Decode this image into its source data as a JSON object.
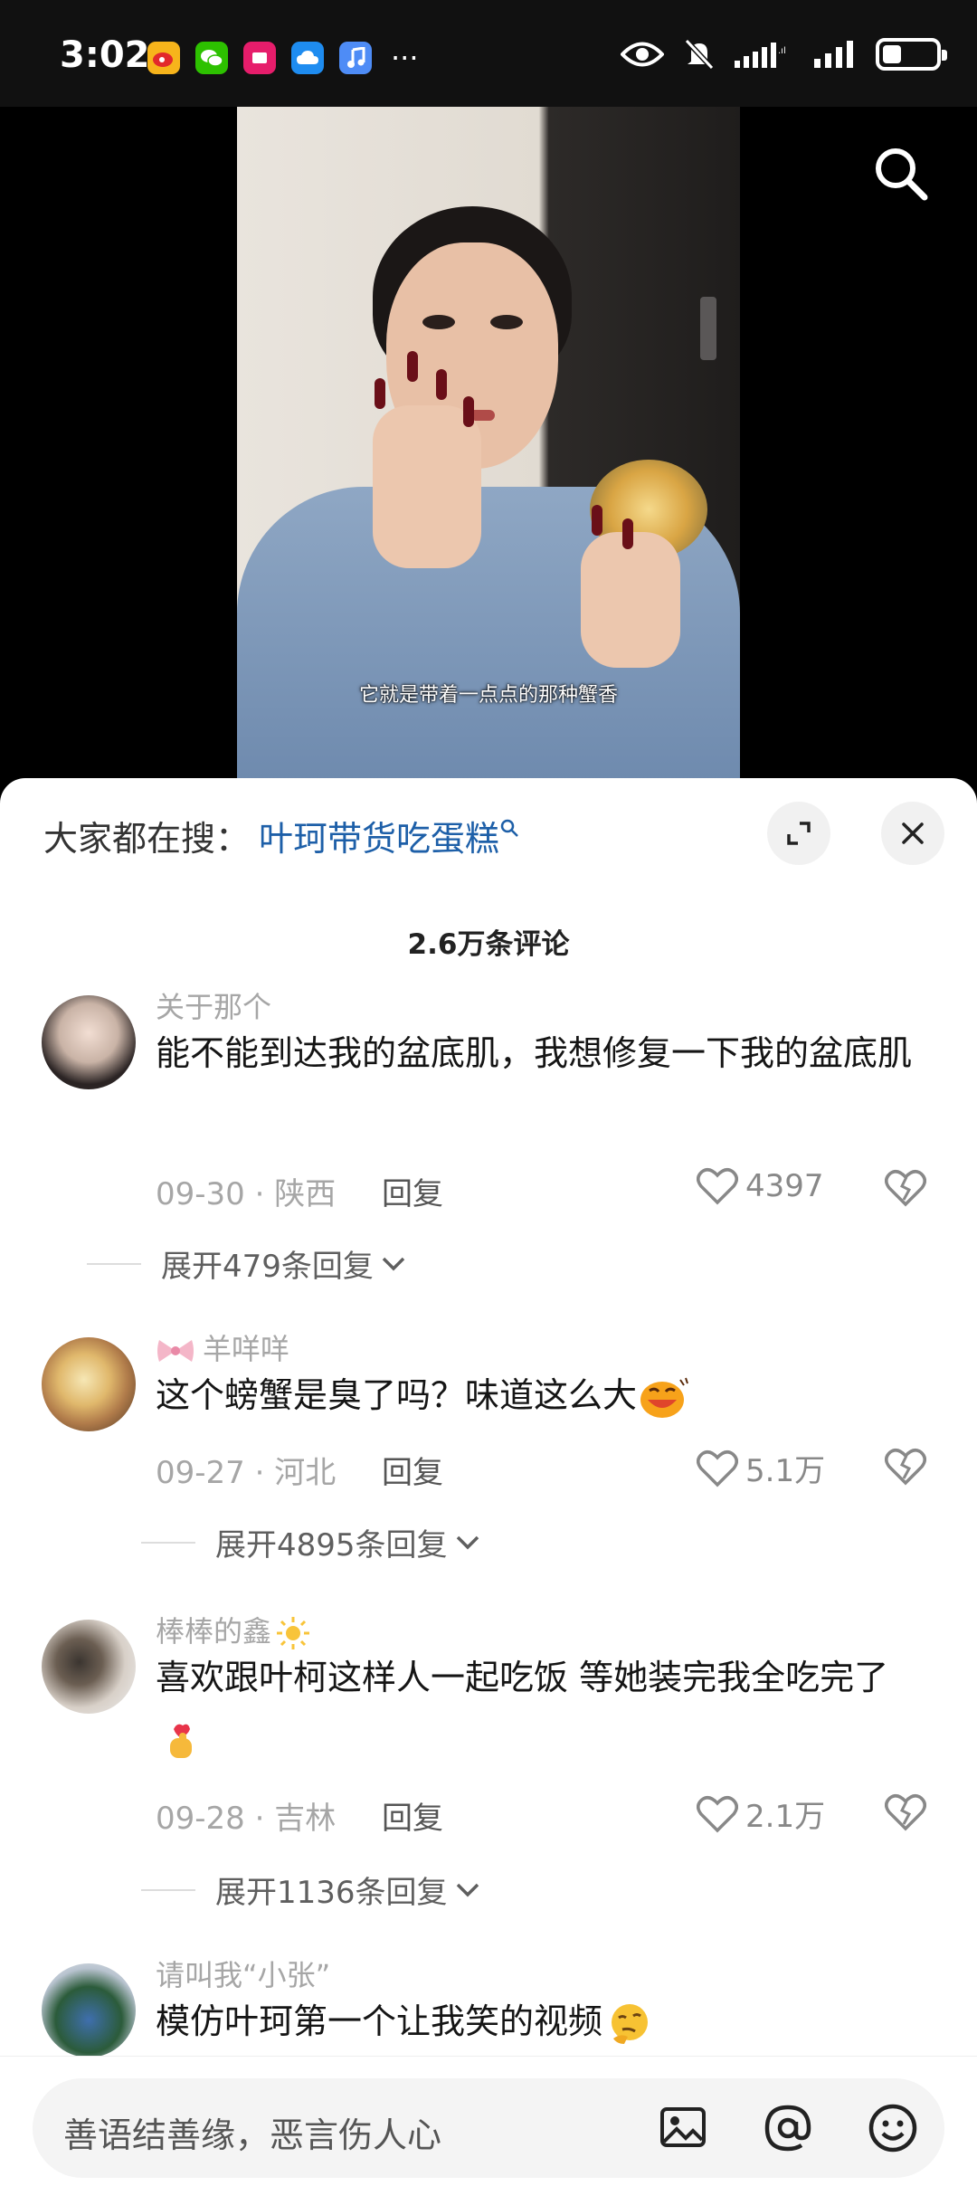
{
  "status_bar": {
    "time": "3:02",
    "app_icons": [
      "weibo-icon",
      "wechat-icon",
      "vipshop-icon",
      "cloud-icon",
      "music-icon"
    ],
    "more": "···",
    "system_icons": [
      "eye-icon",
      "mute-bell-icon",
      "signal-icon",
      "signal-icon",
      "battery-icon"
    ],
    "battery_level": 0.35
  },
  "video": {
    "caption": "它就是带着一点点的那种蟹香"
  },
  "comments_panel": {
    "suggest_prefix": "大家都在搜：",
    "suggest_term": "叶珂带货吃蛋糕",
    "count_label": "2.6万条评论",
    "items": [
      {
        "username": "关于那个",
        "text": "能不能到达我的盆底肌，我想修复一下我的盆底肌",
        "date": "09-30",
        "sep": "·",
        "location": "陕西",
        "reply_label": "回复",
        "likes": "4397",
        "expand_label": "展开479条回复"
      },
      {
        "username": "羊咩咩",
        "username_prefix_icon": "bow-icon",
        "text": "这个螃蟹是臭了吗？味道这么大",
        "emoji": "laughing-emoji",
        "date": "09-27",
        "sep": "·",
        "location": "河北",
        "reply_label": "回复",
        "likes": "5.1万",
        "expand_label": "展开4895条回复"
      },
      {
        "username": "棒棒的鑫",
        "username_suffix_icon": "sun-icon",
        "text": "喜欢跟叶柯这样人一起吃饭 等她装完我全吃完了",
        "emoji": "finger-heart-emoji",
        "date": "09-28",
        "sep": "·",
        "location": "吉林",
        "reply_label": "回复",
        "likes": "2.1万",
        "expand_label": "展开1136条回复"
      },
      {
        "username": "请叫我“小张”",
        "text": "模仿叶珂第一个让我笑的视频",
        "emoji": "thinking-emoji"
      }
    ]
  },
  "input_bar": {
    "placeholder": "善语结善缘，恶言伤人心",
    "icons": [
      "image-icon",
      "at-icon",
      "emoji-icon"
    ]
  },
  "colors": {
    "accent_link": "#1d5fa8",
    "meta_grey": "#a6a6a6",
    "text": "#151515"
  }
}
